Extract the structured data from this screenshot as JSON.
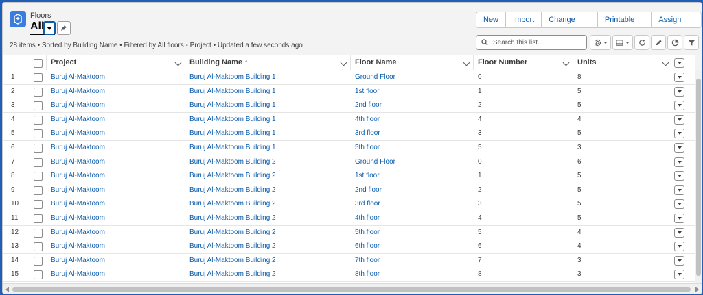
{
  "header": {
    "object_label": "Floors",
    "view_title": "All",
    "list_info": "28 items • Sorted by Building Name • Filtered by All floors - Project • Updated a few seconds ago",
    "actions": [
      "New",
      "Import",
      "Change Owner",
      "Printable View",
      "Assign Label"
    ],
    "search_placeholder": "Search this list...",
    "accent_color": "#0b5cab",
    "icon_color": "#3b7ddd"
  },
  "table": {
    "columns": [
      "Project",
      "Building Name",
      "Floor Name",
      "Floor Number",
      "Units"
    ],
    "sorted_column_arrow": "↑",
    "rows": [
      {
        "n": "1",
        "project": "Buruj Al-Maktoom",
        "building": "Buruj Al-Maktoom Building 1",
        "floor": "Ground Floor",
        "number": "0",
        "units": "8"
      },
      {
        "n": "2",
        "project": "Buruj Al-Maktoom",
        "building": "Buruj Al-Maktoom Building 1",
        "floor": "1st floor",
        "number": "1",
        "units": "5"
      },
      {
        "n": "3",
        "project": "Buruj Al-Maktoom",
        "building": "Buruj Al-Maktoom Building 1",
        "floor": "2nd floor",
        "number": "2",
        "units": "5"
      },
      {
        "n": "4",
        "project": "Buruj Al-Maktoom",
        "building": "Buruj Al-Maktoom Building 1",
        "floor": "4th floor",
        "number": "4",
        "units": "4"
      },
      {
        "n": "5",
        "project": "Buruj Al-Maktoom",
        "building": "Buruj Al-Maktoom Building 1",
        "floor": "3rd floor",
        "number": "3",
        "units": "5"
      },
      {
        "n": "6",
        "project": "Buruj Al-Maktoom",
        "building": "Buruj Al-Maktoom Building 1",
        "floor": "5th floor",
        "number": "5",
        "units": "3"
      },
      {
        "n": "7",
        "project": "Buruj Al-Maktoom",
        "building": "Buruj Al-Maktoom Building 2",
        "floor": "Ground Floor",
        "number": "0",
        "units": "6"
      },
      {
        "n": "8",
        "project": "Buruj Al-Maktoom",
        "building": "Buruj Al-Maktoom Building 2",
        "floor": "1st floor",
        "number": "1",
        "units": "5"
      },
      {
        "n": "9",
        "project": "Buruj Al-Maktoom",
        "building": "Buruj Al-Maktoom Building 2",
        "floor": "2nd floor",
        "number": "2",
        "units": "5"
      },
      {
        "n": "10",
        "project": "Buruj Al-Maktoom",
        "building": "Buruj Al-Maktoom Building 2",
        "floor": "3rd floor",
        "number": "3",
        "units": "5"
      },
      {
        "n": "11",
        "project": "Buruj Al-Maktoom",
        "building": "Buruj Al-Maktoom Building 2",
        "floor": "4th floor",
        "number": "4",
        "units": "5"
      },
      {
        "n": "12",
        "project": "Buruj Al-Maktoom",
        "building": "Buruj Al-Maktoom Building 2",
        "floor": "5th floor",
        "number": "5",
        "units": "4"
      },
      {
        "n": "13",
        "project": "Buruj Al-Maktoom",
        "building": "Buruj Al-Maktoom Building 2",
        "floor": "6th floor",
        "number": "6",
        "units": "4"
      },
      {
        "n": "14",
        "project": "Buruj Al-Maktoom",
        "building": "Buruj Al-Maktoom Building 2",
        "floor": "7th floor",
        "number": "7",
        "units": "3"
      },
      {
        "n": "15",
        "project": "Buruj Al-Maktoom",
        "building": "Buruj Al-Maktoom Building 2",
        "floor": "8th floor",
        "number": "8",
        "units": "3"
      }
    ]
  }
}
